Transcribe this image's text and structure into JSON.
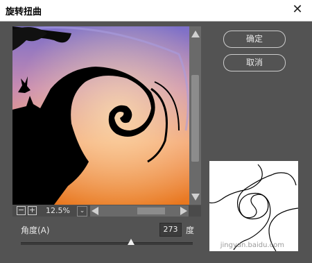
{
  "window": {
    "title": "旋转扭曲",
    "close_glyph": "✕"
  },
  "preview": {
    "zoom": "12.5%",
    "zoom_out_glyph": "−",
    "zoom_in_glyph": "+",
    "dropdown_glyph": "⌄"
  },
  "buttons": {
    "ok": "确定",
    "cancel": "取消"
  },
  "angle": {
    "label": "角度(A)",
    "value": "273",
    "unit": "度",
    "slider_fraction": 0.64
  },
  "watermark": "jingyan.baidu.com",
  "colors": {
    "dialog_bg": "#535353",
    "sky_top": "#7b6fc9",
    "sky_bottom": "#e8761d",
    "silhouette": "#000000"
  }
}
